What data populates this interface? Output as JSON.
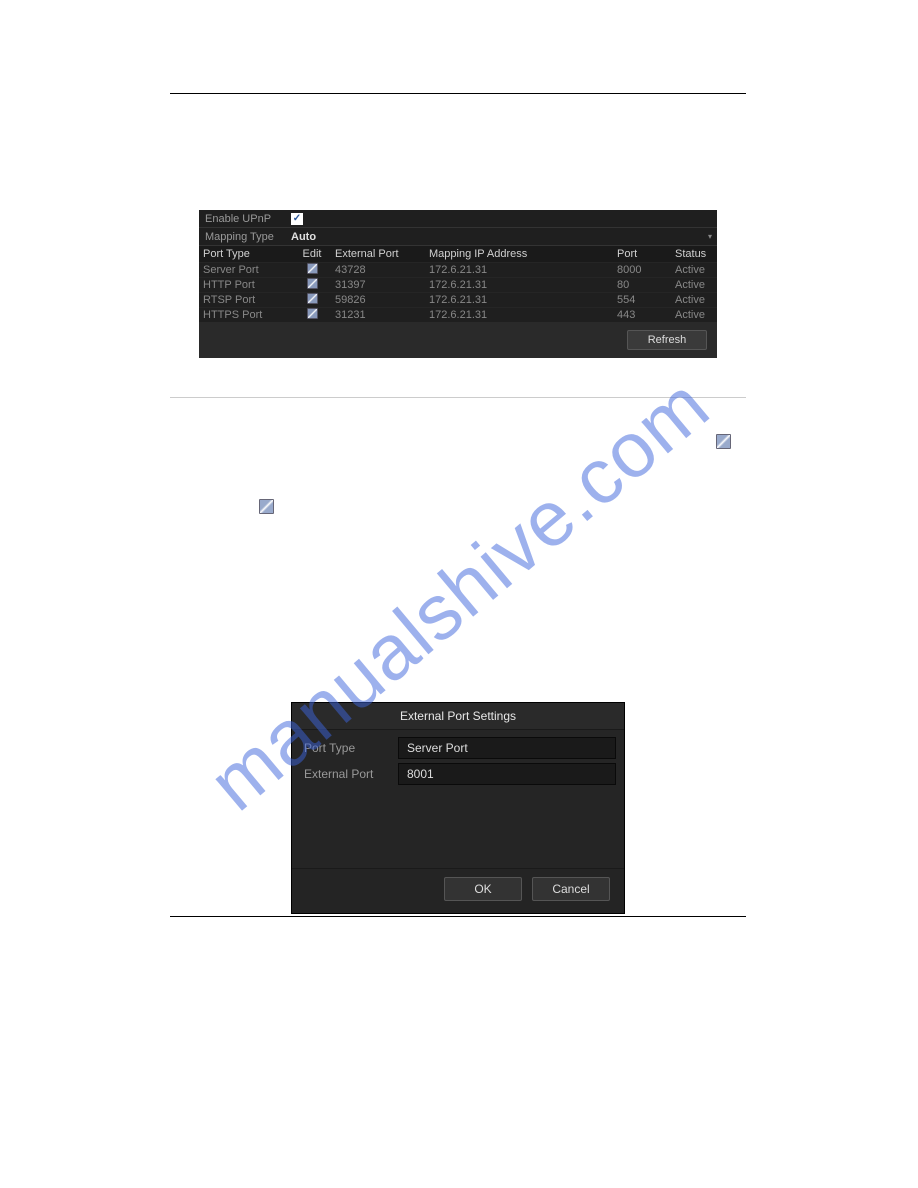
{
  "watermark": "manualshive.com",
  "upnp": {
    "enable_label": "Enable UPnP",
    "enable_checked": true,
    "mapping_label": "Mapping Type",
    "mapping_value": "Auto",
    "headers": {
      "port_type": "Port Type",
      "edit": "Edit",
      "external_port": "External Port",
      "mapping_ip": "Mapping IP Address",
      "port": "Port",
      "status": "Status"
    },
    "rows": [
      {
        "type": "Server Port",
        "ext": "43728",
        "ip": "172.6.21.31",
        "port": "8000",
        "status": "Active"
      },
      {
        "type": "HTTP Port",
        "ext": "31397",
        "ip": "172.6.21.31",
        "port": "80",
        "status": "Active"
      },
      {
        "type": "RTSP Port",
        "ext": "59826",
        "ip": "172.6.21.31",
        "port": "554",
        "status": "Active"
      },
      {
        "type": "HTTPS Port",
        "ext": "31231",
        "ip": "172.6.21.31",
        "port": "443",
        "status": "Active"
      }
    ],
    "refresh_label": "Refresh"
  },
  "dialog": {
    "title": "External Port Settings",
    "port_type_label": "Port Type",
    "port_type_value": "Server Port",
    "external_port_label": "External Port",
    "external_port_value": "8001",
    "ok_label": "OK",
    "cancel_label": "Cancel"
  }
}
